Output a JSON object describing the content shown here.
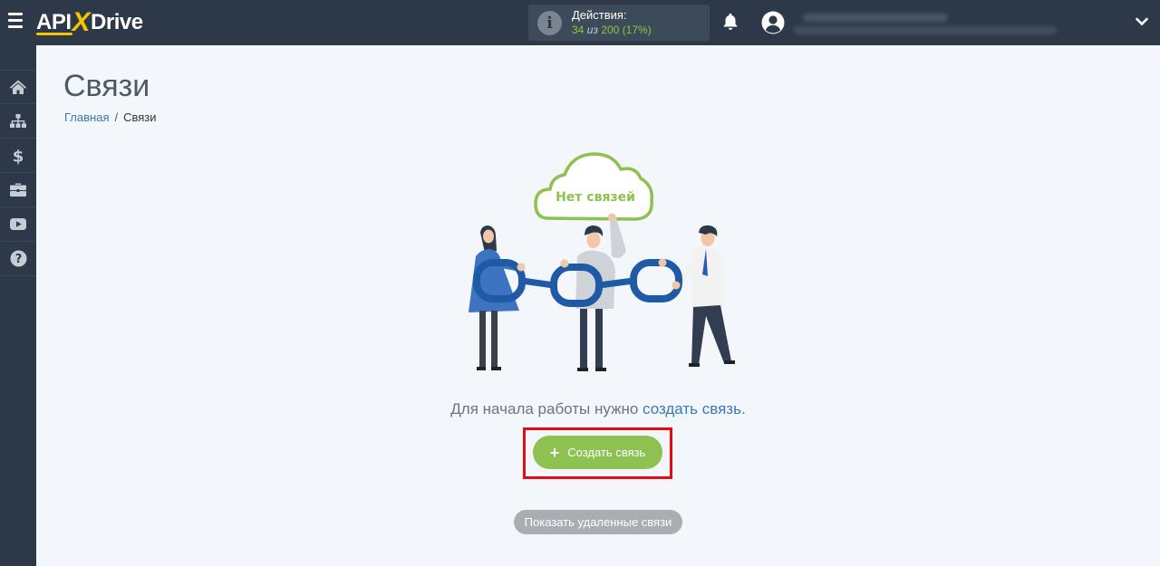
{
  "header": {
    "logo_left": "API",
    "logo_x": "X",
    "logo_right": "Drive",
    "actions": {
      "title": "Действия:",
      "used": "34",
      "of_word": "из",
      "total": "200",
      "percent": "(17%)"
    }
  },
  "sidebar": {
    "items": [
      {
        "icon": "home-icon"
      },
      {
        "icon": "sitemap-icon"
      },
      {
        "icon": "dollar-icon"
      },
      {
        "icon": "briefcase-icon"
      },
      {
        "icon": "youtube-icon"
      },
      {
        "icon": "help-icon"
      }
    ]
  },
  "main": {
    "title": "Связи",
    "breadcrumb": {
      "home": "Главная",
      "separator": "/",
      "current": "Связи"
    },
    "illustration": {
      "cloud_text": "Нет связей"
    },
    "cta_prefix": "Для начала работы нужно ",
    "cta_link": "создать связь",
    "cta_suffix": ".",
    "create_button": "Создать связь",
    "create_button_icon": "+",
    "deleted_button": "Показать удаленные связи"
  },
  "colors": {
    "topbar": "#2d3948",
    "accent_green": "#8dc152",
    "link_blue": "#3a7ab8",
    "highlight_red": "#e20d13",
    "logo_yellow": "#f5c400"
  }
}
